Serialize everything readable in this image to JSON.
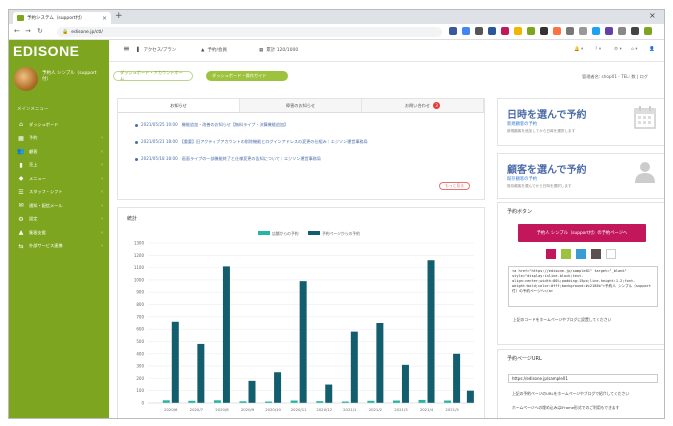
{
  "browser": {
    "tab_title": "予約システム（support付）",
    "address": "edisone.jp/ctl/",
    "new_tab": "+",
    "minimize": "–",
    "close": "×"
  },
  "app": {
    "logo": "EDISONE",
    "user_name": "予約人 シンプル（support付）",
    "menu_caption": "メインメニュー"
  },
  "sidebar": {
    "items": [
      {
        "label": "ダッシュボード",
        "icon": "home-icon"
      },
      {
        "label": "予約",
        "icon": "calendar-icon"
      },
      {
        "label": "顧客",
        "icon": "users-icon"
      },
      {
        "label": "売上",
        "icon": "chart-icon"
      },
      {
        "label": "メニュー",
        "icon": "tag-icon"
      },
      {
        "label": "スタッフ・シフト",
        "icon": "staff-icon"
      },
      {
        "label": "通知・配信メール",
        "icon": "mail-icon"
      },
      {
        "label": "設定",
        "icon": "gear-icon"
      },
      {
        "label": "集客支援",
        "icon": "megaphone-icon"
      },
      {
        "label": "外部サービス連携",
        "icon": "link-icon"
      }
    ]
  },
  "topnav": {
    "hamburger": "≡",
    "plan": "アクセス/プラン",
    "store": "予約/会員",
    "count": "累計 120/1000"
  },
  "subbar": {
    "btn_outline": "ダッシュボード・アカウントホーム",
    "btn_filled": "ダッシュボード・操作ガイド",
    "right_text": "管理者名: shop01 - TEL: 数 | ログ"
  },
  "news": {
    "tabs": [
      "お知らせ",
      "障害のお知らせ",
      "お問い合わせ"
    ],
    "badge": "3",
    "items": [
      "2021/05/25 10:00　機能追加・改善のお知らせ【無料ライプ・決算機能追加】",
      "2021/05/21 18:00　【重要】旧アクティブアカウントの削除機能とログインアドレスの変更の仕組み｜エジソン運営事務局",
      "2021/05/18 18:00　画面ライプの一部機能終了と仕様変更の告知について｜エジソン運営事務局"
    ],
    "more": "もっと見る"
  },
  "stats": {
    "title": "統計"
  },
  "chart_data": {
    "type": "bar",
    "legend": [
      "店舗からの予約",
      "予約ページからの予約"
    ],
    "legend_position": "top",
    "categories": [
      "2020/6",
      "2020/7",
      "2020/8",
      "2020/9",
      "2020/10",
      "2020/11",
      "2020/12",
      "2021/1",
      "2021/2",
      "2021/3",
      "2021/4",
      "2021/5"
    ],
    "series": [
      {
        "name": "店舗からの予約",
        "color": "#26b5a0",
        "values": [
          22,
          18,
          22,
          14,
          12,
          20,
          15,
          12,
          18,
          20,
          25,
          20
        ]
      },
      {
        "name": "予約ページからの予約",
        "color": "#135e6e",
        "values": [
          660,
          480,
          1110,
          180,
          250,
          990,
          150,
          580,
          650,
          310,
          1160,
          400
        ]
      }
    ],
    "extra_last": {
      "value": 100
    },
    "yticks": [
      0,
      100,
      200,
      300,
      400,
      500,
      600,
      700,
      800,
      900,
      1000,
      1100,
      1200,
      1300
    ],
    "ylim": [
      0,
      1300
    ],
    "grid": true
  },
  "right": {
    "card1": {
      "title": "日時を選んで予約",
      "sub": "新規顧客の予約",
      "desc": "新規顧客を追加してから日時を選択します",
      "icon": "calendar-icon"
    },
    "card2": {
      "title": "顧客を選んで予約",
      "sub": "既存顧客の予約",
      "desc": "既存顧客を選んでから日時を選択します",
      "icon": "person-icon"
    },
    "btnbox": {
      "title": "予約ボタン",
      "button": "予約人 シンプル（support付）の予約ページへ",
      "swatches": [
        "#c2185b",
        "#9cc23e",
        "#3a9bd5",
        "#5a5050",
        "#ffffff"
      ],
      "code": "<a href=\"https://edisone.jp/sample01\" target=\"_blank\" style=\"display:inline-block;text-align:center;width:80%;padding:15px;line-height:1.2;font-weight:bold;color:#fff;background:#c2185b\">予約人 シンプル（support付）の予約ページへ</a>",
      "hint": "上記のコードをホームページやブログに設置してください"
    },
    "urlbox": {
      "title": "予約ページURL",
      "url": "https://edisone.jp/sample01",
      "hint1": "上記の予約ページのURLをホームページやブログで紹介してください",
      "hint2": "ホームページへの埋め込みはiFrame形式でのご利用もできます"
    }
  }
}
